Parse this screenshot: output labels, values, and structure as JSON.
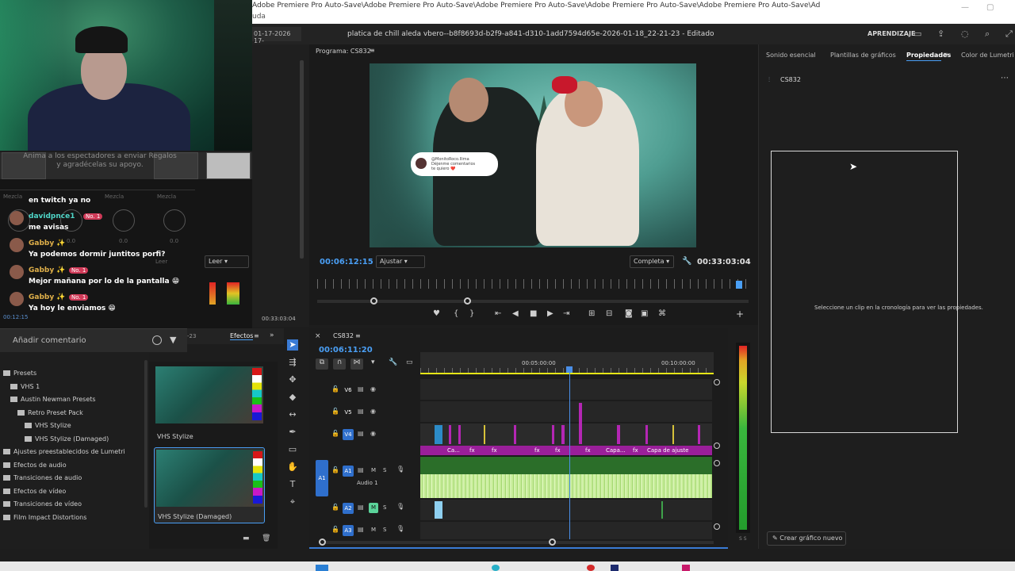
{
  "browser": {
    "tabs_text": "Adobe Premiere Pro Auto-Save\\Adobe Premiere Pro Auto-Save\\Adobe Premiere Pro Auto-Save\\Adobe Premiere Pro Auto-Save\\Adobe Premiere Pro Auto-Save\\Ad",
    "tabs_text2": "uda"
  },
  "titlebar": {
    "title": "platica de chill aleda vbero--b8f8693d-b2f9-a841-d310-1add7594d65e-2026-01-18_22-21-23 - Editado",
    "learn": "APRENDIZAJE"
  },
  "stream": {
    "prompt": "Anima a los espectadores a enviar Regalos y agradécelas su apoyo.",
    "comment_placeholder": "Añadir comentario",
    "chat": [
      {
        "type": "msg",
        "text": "en twitch ya no"
      },
      {
        "type": "user",
        "user": "davidpnce1",
        "badge": "No. 1",
        "color": "#4fd6c8"
      },
      {
        "type": "msg",
        "text": "me avisas"
      },
      {
        "type": "user",
        "user": "Gabby ✨",
        "badge": "",
        "color": "#e0b04a"
      },
      {
        "type": "msg",
        "text": "Ya podemos dormir juntitos porfi?"
      },
      {
        "type": "user",
        "user": "Gabby ✨",
        "badge": "No. 1",
        "color": "#e0b04a"
      },
      {
        "type": "msg",
        "text": "Mejor mañana por lo de la pantalla 😁"
      },
      {
        "type": "user",
        "user": "Gabby ✨",
        "badge": "No. 1",
        "color": "#e0b04a"
      },
      {
        "type": "msg",
        "text": "Ya hoy le enviamos 😁"
      }
    ]
  },
  "source_panel": {
    "date_fragment": "01-17-2026 17-",
    "mix_labels": [
      "Mezcla",
      "Mezcla",
      "Mezcla"
    ],
    "read_label": "Leer",
    "read_label2": "Leer",
    "val_zero": "0.0",
    "timecode": "00:33:03:04",
    "timecode_left": "00:12:15",
    "path_fragment": "...-a841-d310-1add7594d65e-2026-01-18_22-21-23"
  },
  "effects": {
    "tab": "Efectos",
    "tree": [
      {
        "label": "Presets",
        "indent": 0
      },
      {
        "label": "VHS 1",
        "indent": 1
      },
      {
        "label": "Austin Newman Presets",
        "indent": 1
      },
      {
        "label": "Retro Preset Pack",
        "indent": 2
      },
      {
        "label": "VHS Stylize",
        "indent": 3
      },
      {
        "label": "VHS Stylize (Damaged)",
        "indent": 3
      },
      {
        "label": "Ajustes preestablecidos de Lumetri",
        "indent": 0
      },
      {
        "label": "Efectos de audio",
        "indent": 0
      },
      {
        "label": "Transiciones de audio",
        "indent": 0
      },
      {
        "label": "Efectos de vídeo",
        "indent": 0
      },
      {
        "label": "Transiciones de vídeo",
        "indent": 0
      },
      {
        "label": "Film Impact Distortions",
        "indent": 0
      }
    ],
    "thumbs": [
      {
        "label": "VHS Stylize"
      },
      {
        "label": "VHS Stylize (Damaged)"
      }
    ]
  },
  "program": {
    "title": "Programa: CS832",
    "timecode": "00:06:12:15",
    "fit": "Ajustar",
    "quality": "Completa",
    "duration": "00:33:03:04",
    "bubble": "@MonitoRoco.llima\nDéjenme comentarios\nte quiero ❤️"
  },
  "timeline": {
    "sequence": "CS832",
    "timecode": "00:06:11:20",
    "ruler_marks": [
      "00:05:00:00",
      "00:10:00:00"
    ],
    "tracks": [
      {
        "id": "V6",
        "kind": "video"
      },
      {
        "id": "V5",
        "kind": "video"
      },
      {
        "id": "V4",
        "kind": "video"
      },
      {
        "id": "A1",
        "kind": "audio",
        "name": "Audio 1"
      },
      {
        "id": "A2",
        "kind": "audio"
      },
      {
        "id": "A3",
        "kind": "audio"
      }
    ],
    "track_btn_m": "M",
    "track_btn_s": "S",
    "src_a1": "A1",
    "clip_labels": [
      "Ca...",
      "fx",
      "fx",
      "fx",
      "fx",
      "fx",
      "Capa...",
      "fx",
      "Capa de ajuste"
    ]
  },
  "properties": {
    "tabs": [
      "Sonido esencial",
      "Plantillas de gráficos",
      "Propiedades",
      "Color de Lumetri"
    ],
    "active_tab": "Propiedades",
    "clip": "CS832",
    "empty_msg": "Seleccione un clip en la cronología para ver las propiedades.",
    "new_graphic": "Crear gráfico nuevo"
  },
  "meter": {
    "labels": "S S"
  }
}
